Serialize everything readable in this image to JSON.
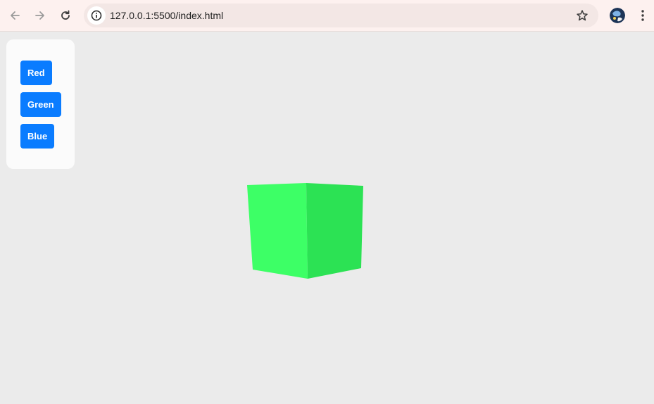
{
  "browser": {
    "url": "127.0.0.1:5500/index.html",
    "icons": {
      "back": "arrow-left-icon",
      "forward": "arrow-right-icon",
      "reload": "reload-icon",
      "site_info": "info-icon",
      "bookmark": "star-icon",
      "profile": "avatar",
      "menu": "kebab-menu-icon"
    }
  },
  "panel": {
    "buttons": [
      {
        "label": "Red",
        "color": "#ff0000"
      },
      {
        "label": "Green",
        "color": "#00ff00"
      },
      {
        "label": "Blue",
        "color": "#0000ff"
      }
    ],
    "button_color": "#0a7cff"
  },
  "scene": {
    "object": "cube",
    "current_color": "#3dff66"
  }
}
